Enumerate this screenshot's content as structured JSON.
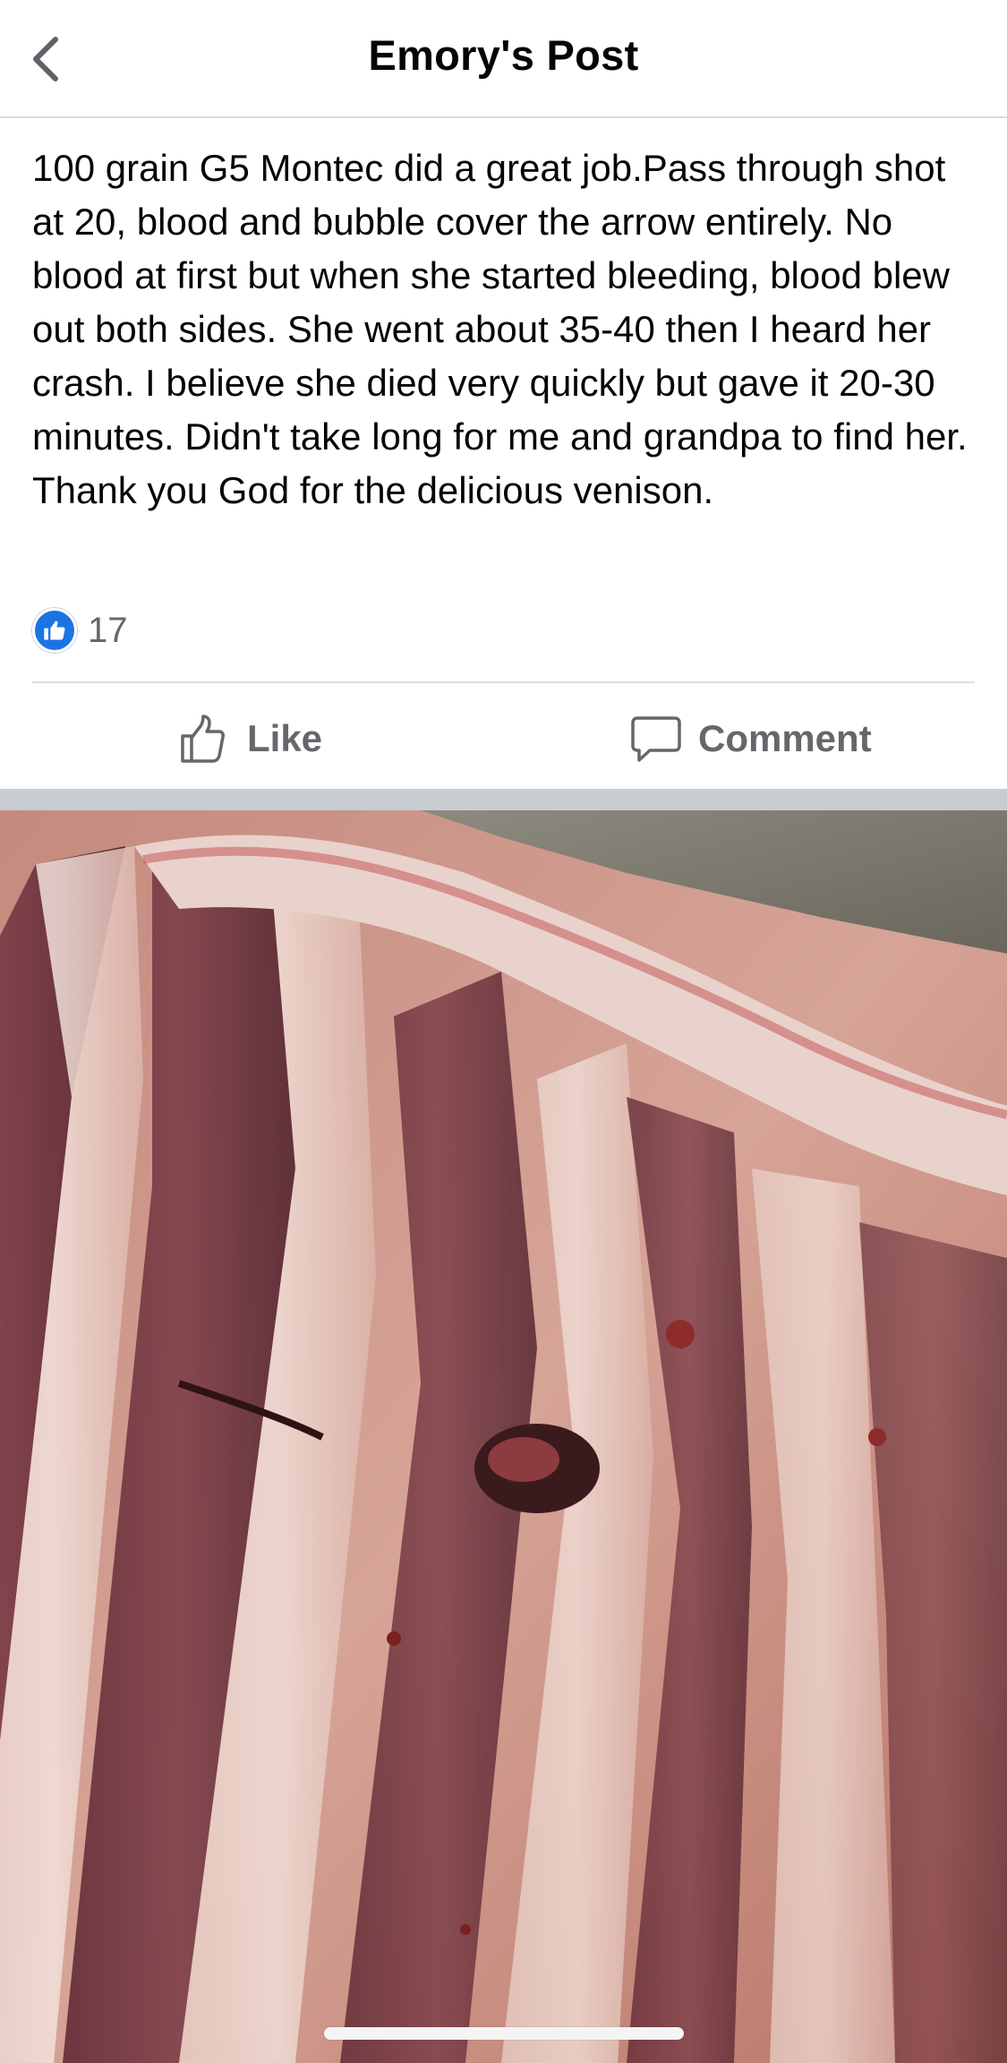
{
  "header": {
    "title": "Emory's Post",
    "back_icon": "chevron-left-icon"
  },
  "post": {
    "text": "100 grain G5 Montec did a great job.Pass through shot at 20, blood and bubble cover the arrow entirely. No blood at first but when she started bleeding, blood blew out both sides. She went about 35-40 then I heard her crash. I believe she died very quickly but gave it 20-30 minutes. Didn't take long for me and grandpa to find her. Thank you God for the delicious venison.",
    "reaction_icon": "like-reaction-icon",
    "reaction_count": "17"
  },
  "actions": {
    "like_label": "Like",
    "like_icon": "thumbs-up-icon",
    "comment_label": "Comment",
    "comment_icon": "speech-bubble-icon"
  },
  "colors": {
    "accent": "#1b74e4",
    "muted_text": "#65676b",
    "separator": "#c9ccd1"
  }
}
